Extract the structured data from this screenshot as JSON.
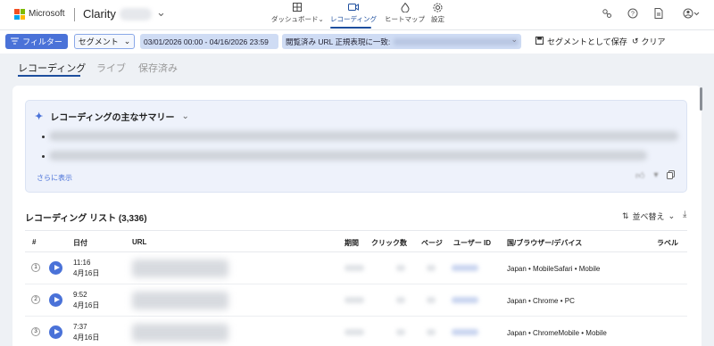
{
  "brand": {
    "company": "Microsoft",
    "app": "Clarity"
  },
  "nav": [
    {
      "label": "ダッシュボード",
      "icon": "dashboard-icon",
      "active": false
    },
    {
      "label": "レコーディング",
      "icon": "recording-icon",
      "active": true
    },
    {
      "label": "ヒートマップ",
      "icon": "heatmap-icon",
      "active": false
    },
    {
      "label": "設定",
      "icon": "settings-icon",
      "active": false
    }
  ],
  "toolbar": {
    "filter_label": "フィルター",
    "segment_label": "セグメント",
    "date_range": "03/01/2026 00:00 - 04/16/2026 23:59",
    "url_filter_label": "閲覧済み URL 正規表現に一致:",
    "save_segment_label": "セグメントとして保存",
    "clear_label": "クリア"
  },
  "tabs": [
    {
      "label": "レコーディング",
      "active": true
    },
    {
      "label": "ライブ",
      "active": false
    },
    {
      "label": "保存済み",
      "active": false
    }
  ],
  "summary": {
    "title": "レコーディングの主なサマリー",
    "show_more": "さらに表示"
  },
  "list": {
    "title": "レコーディング リスト (3,336)",
    "sort_label": "並べ替え",
    "columns": [
      "#",
      "日付",
      "URL",
      "期間",
      "クリック数",
      "ページ",
      "ユーザー ID",
      "国/ブラウザー/デバイス",
      "ラベル"
    ],
    "rows": [
      {
        "num": "1",
        "time": "11:16",
        "date": "4月16日",
        "geo": "Japan • MobileSafari • Mobile"
      },
      {
        "num": "2",
        "time": "9:52",
        "date": "4月16日",
        "geo": "Japan • Chrome • PC"
      },
      {
        "num": "3",
        "time": "7:37",
        "date": "4月16日",
        "geo": "Japan • ChromeMobile • Mobile"
      }
    ]
  },
  "colors": {
    "accent": "#4a72d8",
    "nav_active": "#1d4e9e",
    "chip_bg": "#cfdcf4"
  }
}
